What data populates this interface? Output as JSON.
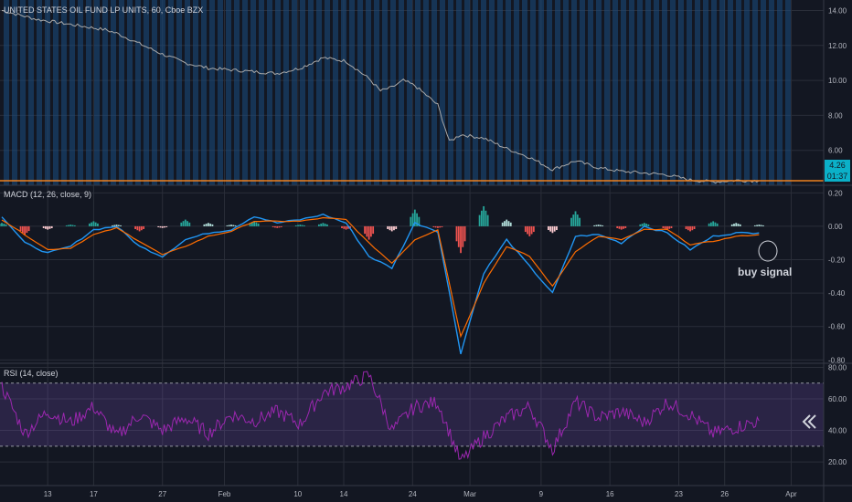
{
  "colors": {
    "background": "#131722",
    "grid": "#2a2e39",
    "text": "#b2b5be",
    "price_line": "#a9a9a9",
    "stripe": "#1a4d80",
    "level_line": "#f0821e",
    "macd_line": "#2196f3",
    "signal_line": "#ff6d00",
    "hist_up": "#26a69a",
    "hist_up_light": "#b2dfdb",
    "hist_down": "#ef5350",
    "hist_down_light": "#ffcdd2",
    "rsi_line": "#9c27b0",
    "rsi_band": "#7e57c2",
    "price_badge": "#0bb0c8",
    "badge_text": "#131722",
    "annotation": "#d1d4dc"
  },
  "header": {
    "price_title": "UNITED STATES OIL FUND LP UNITS, 60, Cboe BZX",
    "macd_title": "MACD (12, 26, close, 9)",
    "rsi_title": "RSI (14, close)"
  },
  "badges": {
    "price": "4.26",
    "countdown": "01:37"
  },
  "annotation": {
    "text": "buy signal"
  },
  "nav_icon": "double-chevron-left-icon",
  "chart_data": [
    {
      "type": "line",
      "title": "UNITED STATES OIL FUND LP UNITS, 60, Cboe BZX",
      "x": [
        0,
        1.5,
        3,
        4.5,
        5,
        6,
        7,
        8,
        9,
        10,
        11,
        12,
        13,
        14,
        15,
        16,
        16.5,
        17,
        17.5,
        18,
        19,
        19.5,
        20,
        21,
        22,
        23,
        24,
        25,
        26,
        27,
        28,
        29,
        30,
        31,
        32,
        33
      ],
      "values": [
        14.0,
        13.5,
        13.2,
        12.9,
        12.7,
        12.1,
        11.5,
        11.0,
        10.7,
        10.6,
        10.5,
        10.4,
        10.7,
        11.3,
        11.1,
        10.1,
        9.4,
        9.6,
        10.0,
        9.7,
        8.6,
        6.5,
        6.9,
        6.7,
        6.1,
        5.6,
        4.9,
        5.4,
        5.0,
        4.8,
        4.7,
        4.6,
        4.3,
        4.2,
        4.28,
        4.26
      ],
      "ylim": [
        4.0,
        14.6
      ],
      "y_ticks": [
        "14.00",
        "12.00",
        "10.00",
        "8.00",
        "6.00"
      ],
      "level": 4.26
    },
    {
      "type": "line",
      "title": "MACD (12, 26, close, 9)",
      "x": [
        0,
        1,
        2,
        3,
        4,
        5,
        6,
        7,
        8,
        9,
        10,
        11,
        12,
        13,
        14,
        15,
        16,
        17,
        18,
        19,
        20,
        21,
        22,
        23,
        24,
        25,
        26,
        27,
        28,
        29,
        30,
        31,
        32,
        33
      ],
      "series": [
        {
          "name": "MACD",
          "values": [
            0.06,
            -0.1,
            -0.16,
            -0.12,
            -0.02,
            0.0,
            -0.12,
            -0.18,
            -0.08,
            -0.04,
            -0.02,
            0.06,
            0.02,
            0.04,
            0.07,
            0.02,
            -0.18,
            -0.25,
            0.02,
            -0.03,
            -0.76,
            -0.28,
            -0.08,
            -0.24,
            -0.4,
            -0.06,
            -0.05,
            -0.1,
            0.0,
            -0.04,
            -0.14,
            -0.06,
            -0.04,
            -0.04
          ]
        },
        {
          "name": "Signal",
          "values": [
            0.04,
            -0.05,
            -0.14,
            -0.13,
            -0.05,
            -0.01,
            -0.09,
            -0.17,
            -0.12,
            -0.06,
            -0.03,
            0.03,
            0.03,
            0.03,
            0.05,
            0.04,
            -0.1,
            -0.22,
            -0.08,
            -0.02,
            -0.66,
            -0.34,
            -0.12,
            -0.18,
            -0.36,
            -0.15,
            -0.06,
            -0.08,
            -0.02,
            -0.02,
            -0.11,
            -0.09,
            -0.06,
            -0.05
          ]
        }
      ],
      "histogram": [
        0.02,
        -0.05,
        -0.02,
        0.01,
        0.03,
        0.01,
        -0.03,
        -0.01,
        0.04,
        0.02,
        0.01,
        0.03,
        -0.01,
        0.01,
        0.02,
        -0.02,
        -0.08,
        -0.03,
        0.1,
        -0.01,
        -0.16,
        0.12,
        0.04,
        -0.06,
        -0.04,
        0.09,
        0.01,
        -0.02,
        0.02,
        -0.02,
        -0.03,
        0.03,
        0.02,
        0.01
      ],
      "ylim": [
        -0.82,
        0.24
      ],
      "y_ticks": [
        "0.20",
        "0.00",
        "-0.20",
        "-0.40",
        "-0.60",
        "-0.80"
      ]
    },
    {
      "type": "line",
      "title": "RSI (14, close)",
      "x": [
        0,
        1,
        2,
        3,
        4,
        5,
        6,
        7,
        8,
        9,
        10,
        11,
        12,
        13,
        14,
        15,
        16,
        17,
        18,
        19,
        20,
        21,
        22,
        23,
        24,
        25,
        26,
        27,
        28,
        29,
        30,
        31,
        32,
        33
      ],
      "values": [
        68,
        38,
        52,
        45,
        55,
        36,
        50,
        40,
        48,
        38,
        50,
        46,
        52,
        44,
        64,
        68,
        75,
        40,
        55,
        58,
        20,
        36,
        48,
        55,
        28,
        58,
        48,
        52,
        45,
        58,
        50,
        38,
        42,
        46
      ],
      "ylim": [
        5,
        82
      ],
      "y_ticks": [
        "80.00",
        "60.00",
        "40.00",
        "20.00"
      ],
      "bands": [
        30,
        70
      ]
    }
  ],
  "x_axis": {
    "labels": [
      {
        "text": "13",
        "x": 2
      },
      {
        "text": "17",
        "x": 4
      },
      {
        "text": "27",
        "x": 7
      },
      {
        "text": "Feb",
        "x": 9.7
      },
      {
        "text": "10",
        "x": 12.9
      },
      {
        "text": "14",
        "x": 14.9
      },
      {
        "text": "24",
        "x": 17.9
      },
      {
        "text": "Mar",
        "x": 20.4
      },
      {
        "text": "9",
        "x": 23.5
      },
      {
        "text": "16",
        "x": 26.5
      },
      {
        "text": "23",
        "x": 29.5
      },
      {
        "text": "26",
        "x": 31.5
      },
      {
        "text": "Apr",
        "x": 34.4
      }
    ]
  }
}
